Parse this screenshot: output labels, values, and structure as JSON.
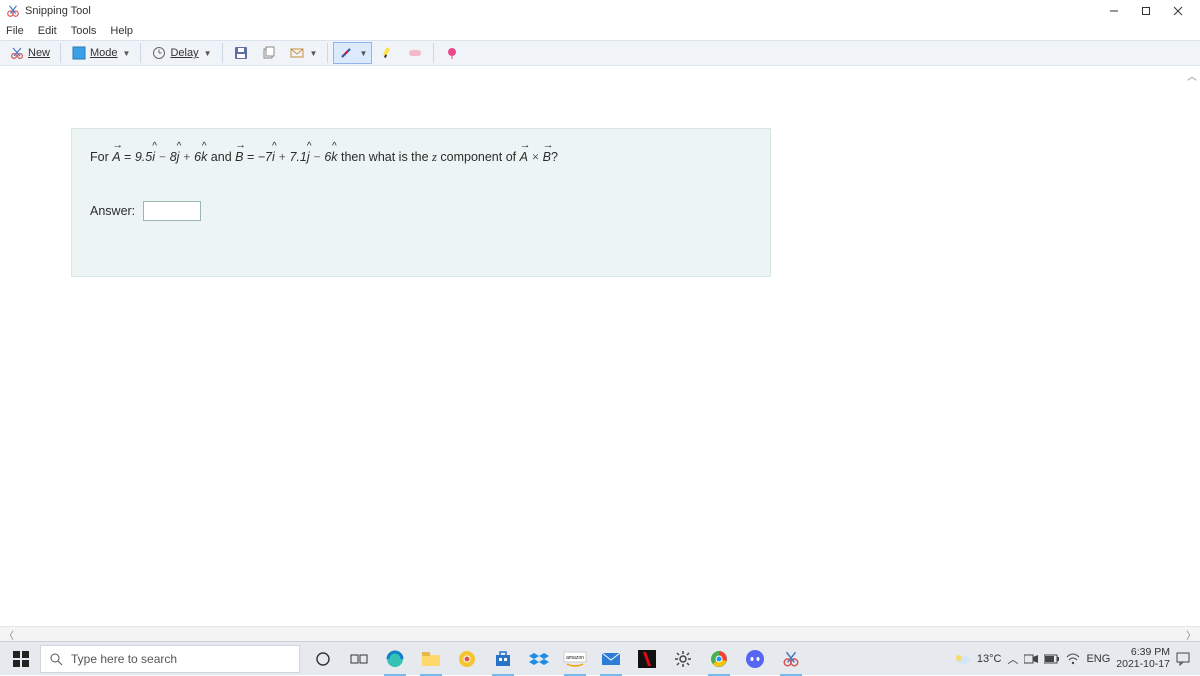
{
  "title": "Snipping Tool",
  "menu": {
    "file": "File",
    "edit": "Edit",
    "tools": "Tools",
    "help": "Help"
  },
  "toolbar": {
    "new": "New",
    "mode": "Mode",
    "delay": "Delay"
  },
  "question": {
    "prefix": "For ",
    "A_label": "A",
    "eq": " = ",
    "A_i": "9.5",
    "A_j": "8",
    "A_k": "6",
    "and": " and ",
    "B_label": "B",
    "B_i": "−7",
    "B_j": "7.1",
    "B_k": "6",
    "tail": " then what is the ",
    "zvar": "z",
    "tail2": " component of ",
    "cross": " × ",
    "qmark": "?",
    "answer_label": "Answer:"
  },
  "taskbar": {
    "search_placeholder": "Type here to search"
  },
  "tray": {
    "temp": "13°C",
    "lang": "ENG",
    "time": "6:39 PM",
    "date": "2021-10-17"
  }
}
